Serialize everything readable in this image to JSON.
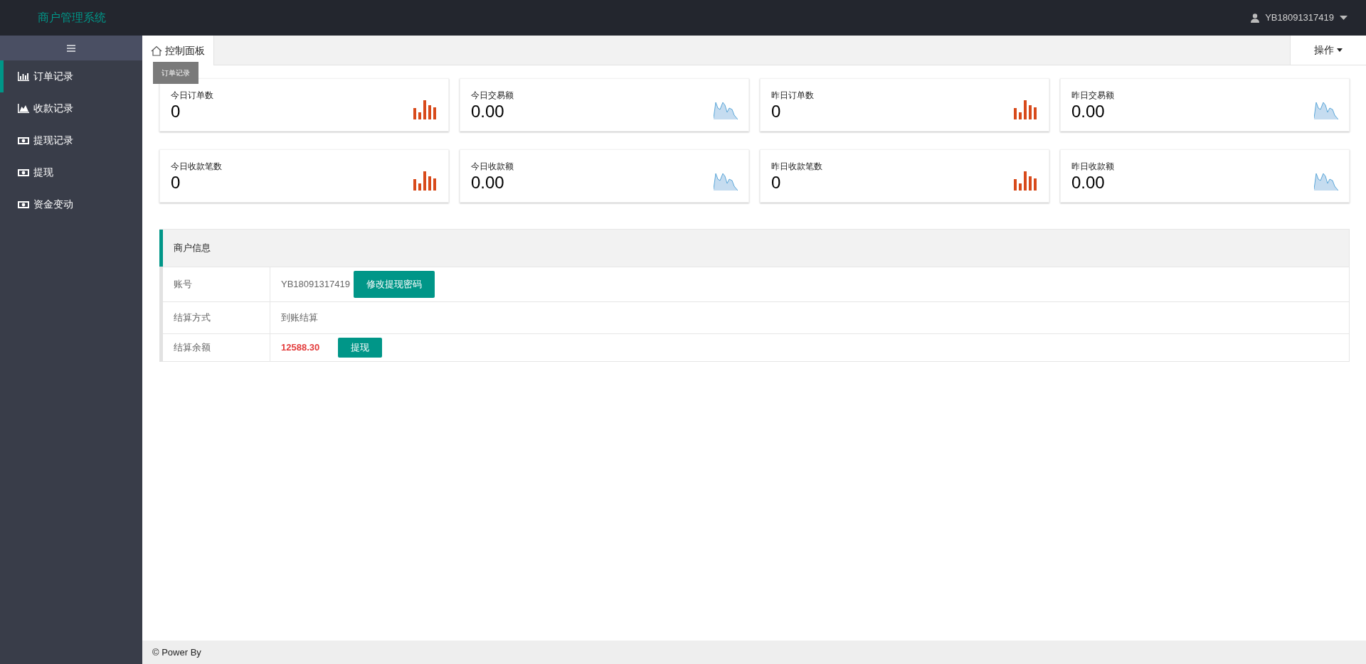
{
  "header": {
    "title": "商户管理系统",
    "user": "YB18091317419"
  },
  "sidebar": {
    "items": [
      {
        "label": "订单记录",
        "kind": "bar",
        "selected": true
      },
      {
        "label": "收款记录",
        "kind": "area",
        "selected": false
      },
      {
        "label": "提现记录",
        "kind": "money",
        "selected": false
      },
      {
        "label": "提现",
        "kind": "money",
        "selected": false
      },
      {
        "label": "资金变动",
        "kind": "money",
        "selected": false
      }
    ]
  },
  "tooltip": "订单记录",
  "tabs": [
    {
      "label": "控制面板",
      "selected": true
    }
  ],
  "actions_button": "操作",
  "stats": [
    {
      "label": "今日订单数",
      "value": "0",
      "kind": "bar"
    },
    {
      "label": "今日交易额",
      "value": "0.00",
      "kind": "area"
    },
    {
      "label": "昨日订单数",
      "value": "0",
      "kind": "bar"
    },
    {
      "label": "昨日交易额",
      "value": "0.00",
      "kind": "area"
    },
    {
      "label": "今日收款笔数",
      "value": "0",
      "kind": "bar"
    },
    {
      "label": "今日收款额",
      "value": "0.00",
      "kind": "area"
    },
    {
      "label": "昨日收款笔数",
      "value": "0",
      "kind": "bar"
    },
    {
      "label": "昨日收款额",
      "value": "0.00",
      "kind": "area"
    }
  ],
  "merchant": {
    "title": "商户信息",
    "rows": [
      {
        "label": "账号",
        "value": "YB18091317419",
        "button": "修改提现密码",
        "kind": "plain"
      },
      {
        "label": "结算方式",
        "value": "到账结算",
        "kind": "plain"
      },
      {
        "label": "结算余额",
        "value": "12588.30",
        "button": "提现",
        "kind": "amount"
      }
    ]
  },
  "footer": "© Power By"
}
